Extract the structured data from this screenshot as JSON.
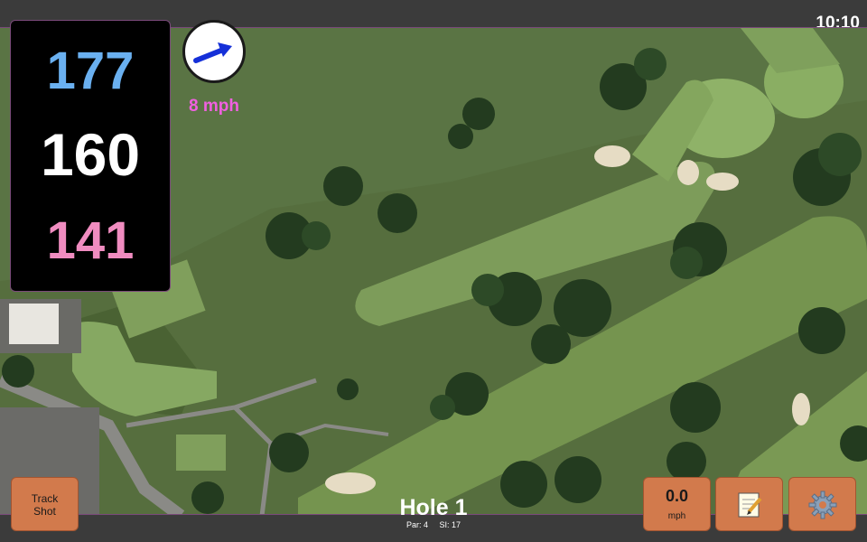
{
  "status": {
    "time": "10:10"
  },
  "distances": {
    "back": "177",
    "middle": "160",
    "front": "141"
  },
  "wind": {
    "speed": "8 mph",
    "icon": "wind-direction-arrow-icon"
  },
  "hole": {
    "title": "Hole 1",
    "par": "Par: 4",
    "stroke_index": "SI: 17"
  },
  "buttons": {
    "track_shot_line1": "Track",
    "track_shot_line2": "Shot",
    "speed_value": "0.0",
    "speed_unit": "mph",
    "notes_icon": "notepad-icon",
    "settings_icon": "gear-icon"
  },
  "colors": {
    "back_distance": "#6ab0f0",
    "middle_distance": "#ffffff",
    "front_distance": "#f08cc0",
    "wind_text": "#f060e0",
    "button_bg": "#d27a4c"
  }
}
